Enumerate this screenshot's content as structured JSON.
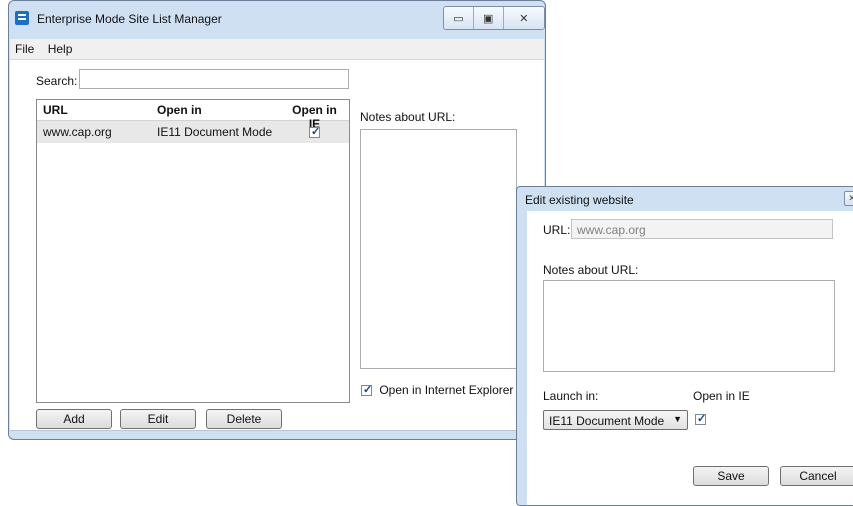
{
  "main_window": {
    "title": "Enterprise Mode Site List Manager",
    "controls": {
      "minimize": "▭",
      "maximize": "▣",
      "close": "✕"
    },
    "menu": [
      "File",
      "Help"
    ],
    "search_label": "Search:",
    "search_value": "",
    "table": {
      "columns": [
        "URL",
        "Open in",
        "Open in IE"
      ],
      "rows": [
        {
          "url": "www.cap.org",
          "open_in": "IE11 Document Mode",
          "open_in_ie": true
        }
      ]
    },
    "notes_label": "Notes about URL:",
    "open_in_ie_checkbox": {
      "label": "Open in Internet Explorer",
      "checked": true
    },
    "buttons": {
      "add": "Add",
      "edit": "Edit",
      "delete": "Delete"
    }
  },
  "dialog": {
    "title": "Edit existing website",
    "close": "✕",
    "url_label": "URL:",
    "url_value": "www.cap.org",
    "notes_label": "Notes about URL:",
    "launch_label": "Launch in:",
    "launch_value": "IE11 Document Mode",
    "open_in_ie_label": "Open in IE",
    "open_in_ie_checked": true,
    "buttons": {
      "save": "Save",
      "cancel": "Cancel"
    }
  },
  "colors": {
    "window_frame": "#cfe0f3",
    "selected_row": "#e8e8e8",
    "app_icon": "#1f6fbf"
  }
}
